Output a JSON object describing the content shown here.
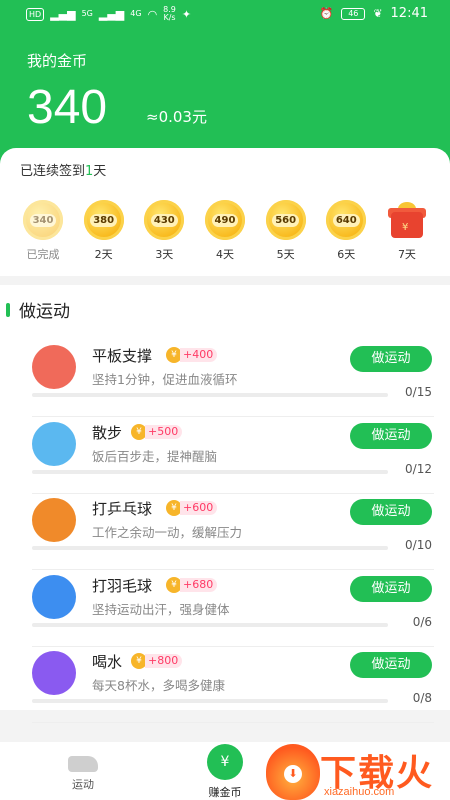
{
  "status_bar": {
    "hd": "HD",
    "net1": "5G",
    "net2": "4G",
    "speed": "8.9",
    "speed_unit": "K/s",
    "battery": "46",
    "time": "12:41"
  },
  "header": {
    "title": "我的金币",
    "amount": "340",
    "rmb": "≈0.03元"
  },
  "checkin": {
    "prefix": "已连续签到",
    "days": "1",
    "suffix": "天",
    "items": [
      {
        "value": "340",
        "label": "已完成",
        "done": true
      },
      {
        "value": "380",
        "label": "2天"
      },
      {
        "value": "430",
        "label": "3天"
      },
      {
        "value": "490",
        "label": "4天"
      },
      {
        "value": "560",
        "label": "5天"
      },
      {
        "value": "640",
        "label": "6天"
      },
      {
        "value": "",
        "label": "7天",
        "gift": true
      }
    ]
  },
  "sport": {
    "title": "做运动",
    "tasks": [
      {
        "name": "平板支撑",
        "reward": "+400",
        "desc": "坚持1分钟，促进血液循环",
        "button": "做运动",
        "count": "0/15",
        "progress": 0,
        "icon": "plank-icon",
        "color": "#f06a5a"
      },
      {
        "name": "散步",
        "reward": "+500",
        "desc": "饭后百步走，提神醒脑",
        "button": "做运动",
        "count": "0/12",
        "progress": 0,
        "icon": "sneaker-icon",
        "color": "#5bb8f0"
      },
      {
        "name": "打乒乓球",
        "reward": "+600",
        "desc": "工作之余动一动，缓解压力",
        "button": "做运动",
        "count": "0/10",
        "progress": 0,
        "icon": "pingpong-icon",
        "color": "#f08a2a"
      },
      {
        "name": "打羽毛球",
        "reward": "+680",
        "desc": "坚持运动出汗，强身健体",
        "button": "做运动",
        "count": "0/6",
        "progress": 0,
        "icon": "badminton-icon",
        "color": "#3d8ef0"
      },
      {
        "name": "喝水",
        "reward": "+800",
        "desc": "每天8杯水，多喝多健康",
        "button": "做运动",
        "count": "0/8",
        "progress": 0,
        "icon": "water-cup-icon",
        "color": "#8a5af0"
      }
    ]
  },
  "bottom_nav": {
    "items": [
      {
        "label": "运动",
        "icon": "sneaker-icon"
      },
      {
        "label": "赚金币",
        "icon": "yen-coin-icon",
        "active": true
      }
    ]
  },
  "watermark": {
    "cn": "下载火",
    "en": "xiazaihuo.com"
  }
}
